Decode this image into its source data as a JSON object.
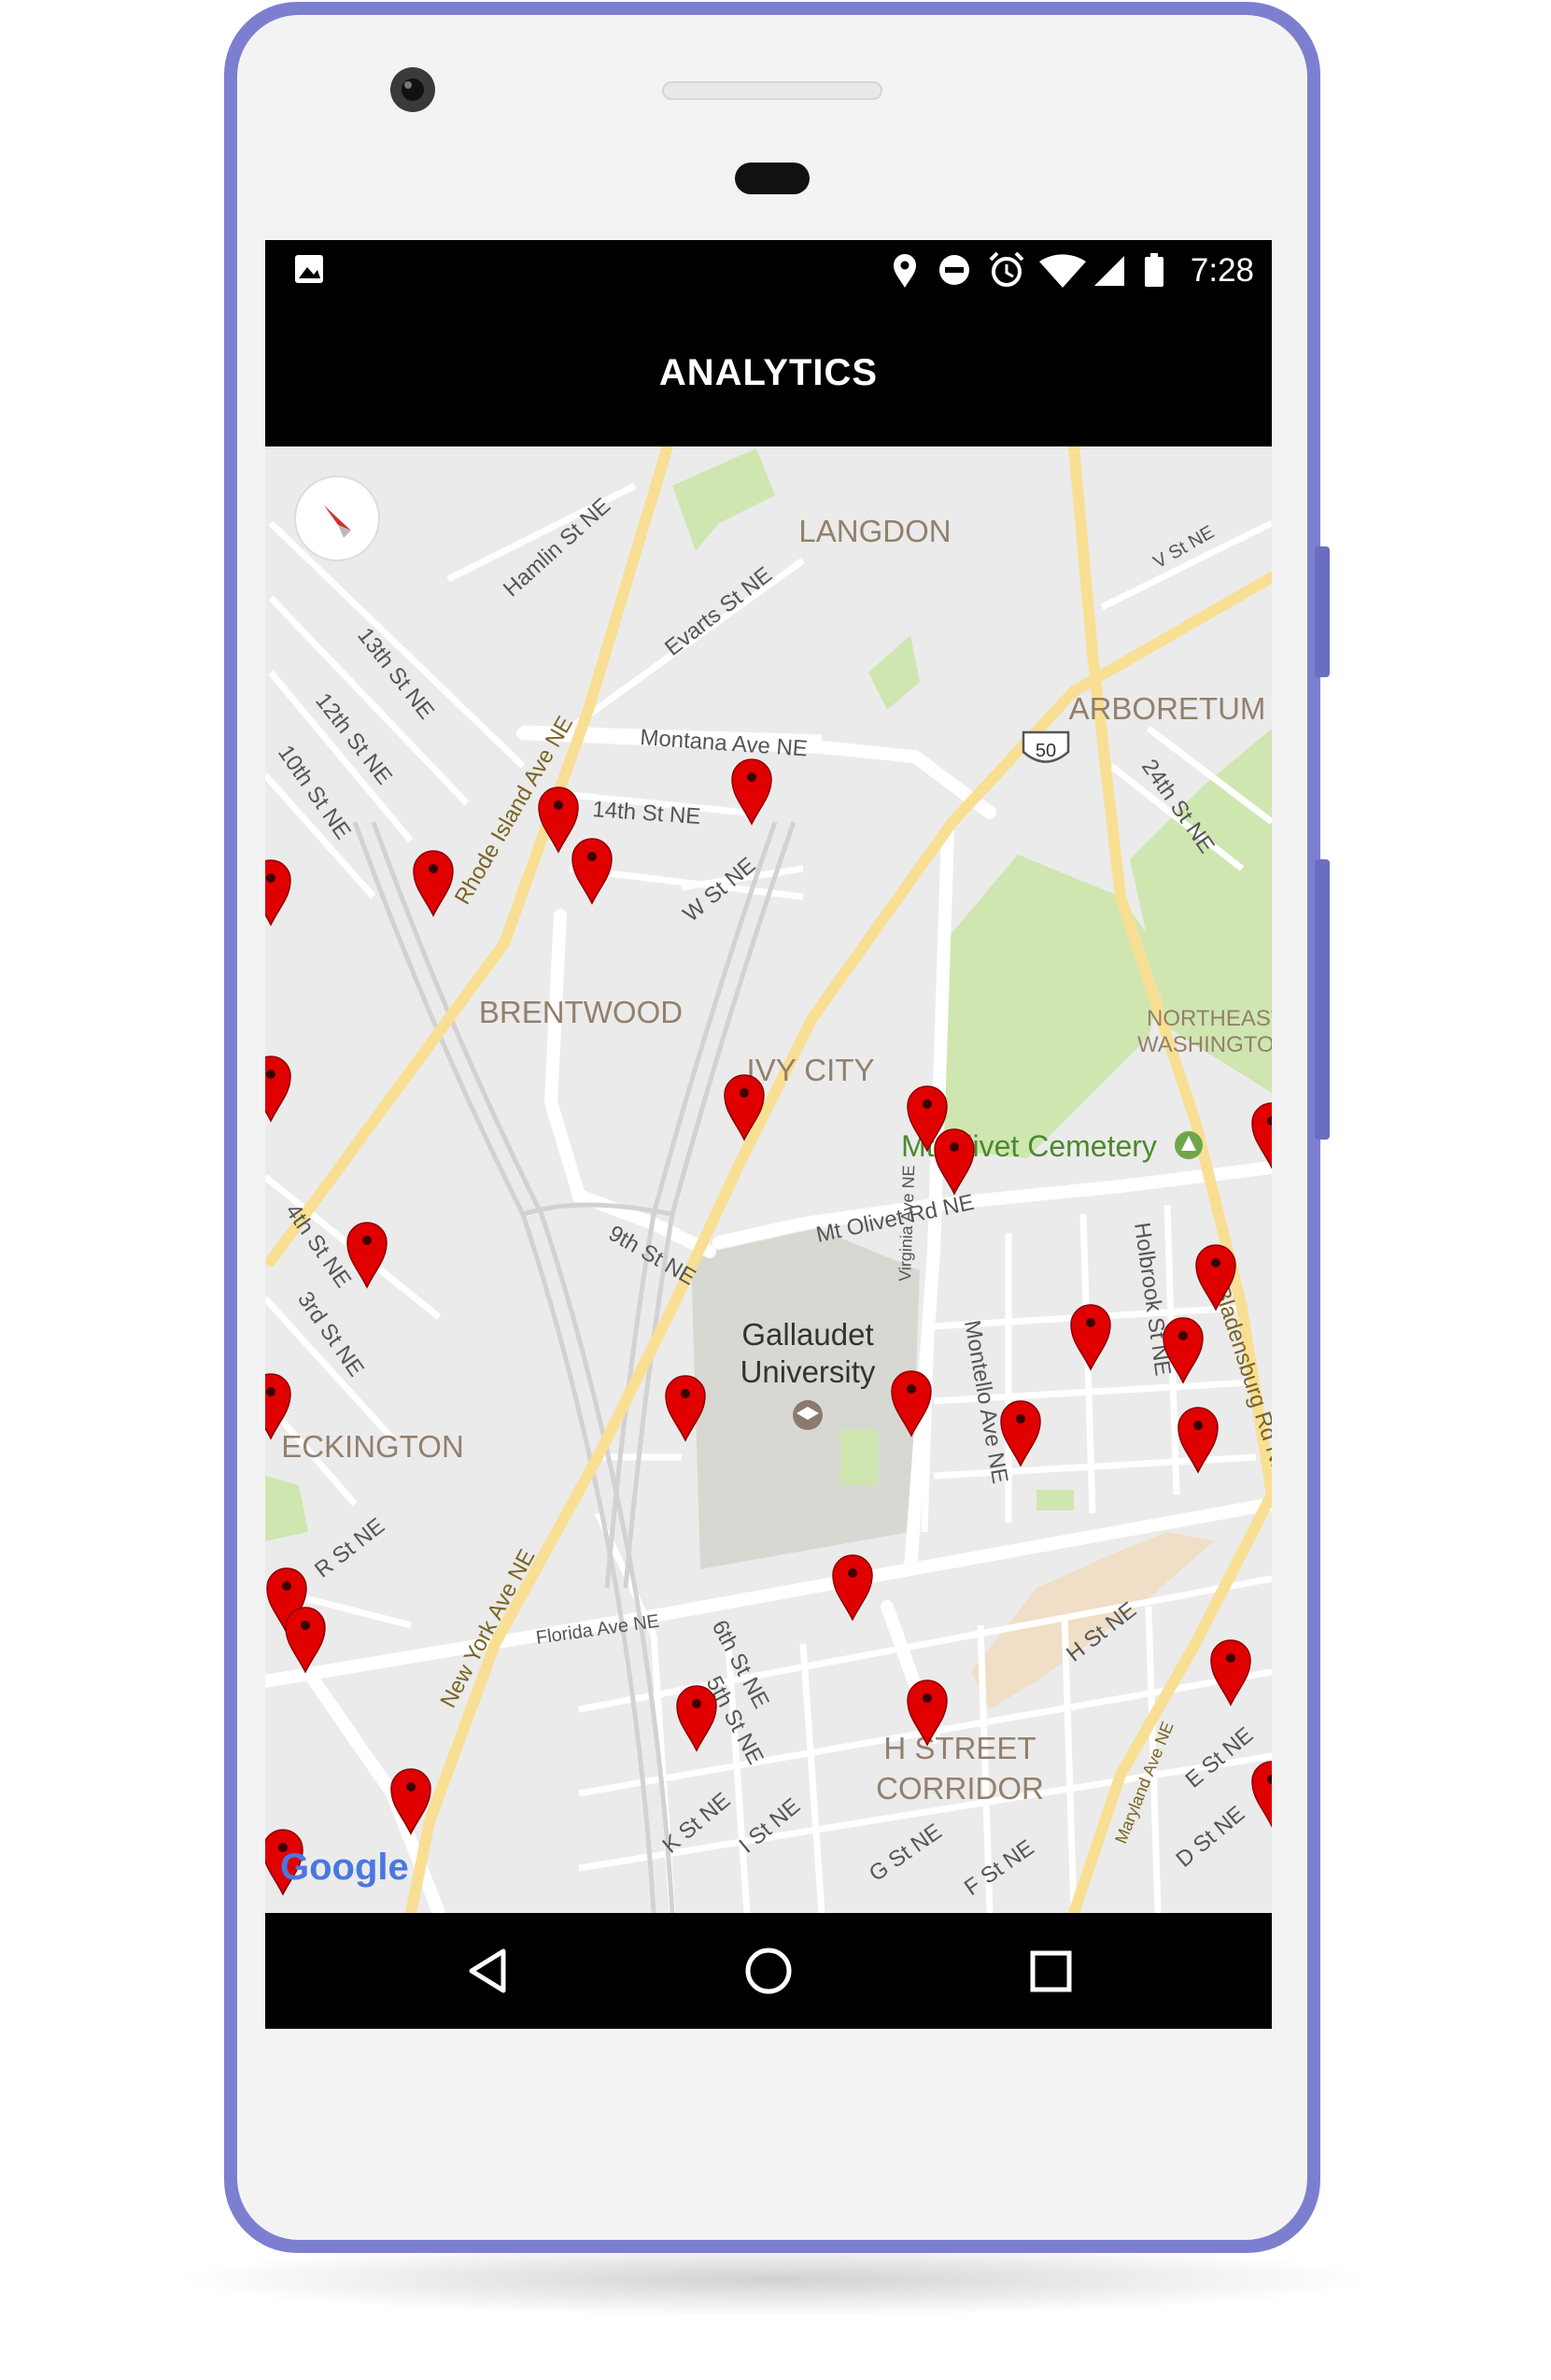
{
  "status_bar": {
    "time": "7:28",
    "icons": [
      "image-icon",
      "location-icon",
      "do-not-disturb-icon",
      "alarm-icon",
      "wifi-icon",
      "signal-icon",
      "battery-icon"
    ]
  },
  "app_bar": {
    "title": "ANALYTICS"
  },
  "map": {
    "provider_logo": "Google",
    "neighborhoods": [
      "LANGDON",
      "ARBORETUM",
      "BRENTWOOD",
      "IVY CITY",
      "ECKINGTON",
      "NORTHEAST",
      "WASHINGTON",
      "H STREET",
      "CORRIDOR"
    ],
    "places": {
      "gallaudet_line1": "Gallaudet",
      "gallaudet_line2": "University",
      "cemetery": "Mt Olivet Cemetery"
    },
    "route_shield": "50",
    "streets": [
      "Hamlin St NE",
      "Evarts St NE",
      "V St NE",
      "13th St NE",
      "12th St NE",
      "10th St NE",
      "Rhode Island Ave NE",
      "Montana Ave NE",
      "14th St NE",
      "W St NE",
      "24th St NE",
      "4th St NE",
      "3rd St NE",
      "9th St NE",
      "Mt Olivet Rd NE",
      "Holbrook St NE",
      "Montello Ave NE",
      "Bladensburg Rd NE",
      "Florida Ave NE",
      "New York Ave NE",
      "R St NE",
      "6th St NE",
      "5th St NE",
      "H St NE",
      "K St NE",
      "I St NE",
      "G St NE",
      "F St NE",
      "Maryland Ave NE",
      "E St NE",
      "D St NE",
      "Virginia Ave NE"
    ],
    "marker_count": 26,
    "marker_color": "#e10000"
  },
  "nav_bar": {
    "buttons": [
      "back-button",
      "home-button",
      "recents-button"
    ]
  },
  "colors": {
    "device_frame": "#7c7fd0",
    "app_bar": "#000000",
    "map_bg": "#ebebeb",
    "park": "#cfe6b0",
    "major_road": "#f9df94",
    "marker": "#e10000"
  }
}
